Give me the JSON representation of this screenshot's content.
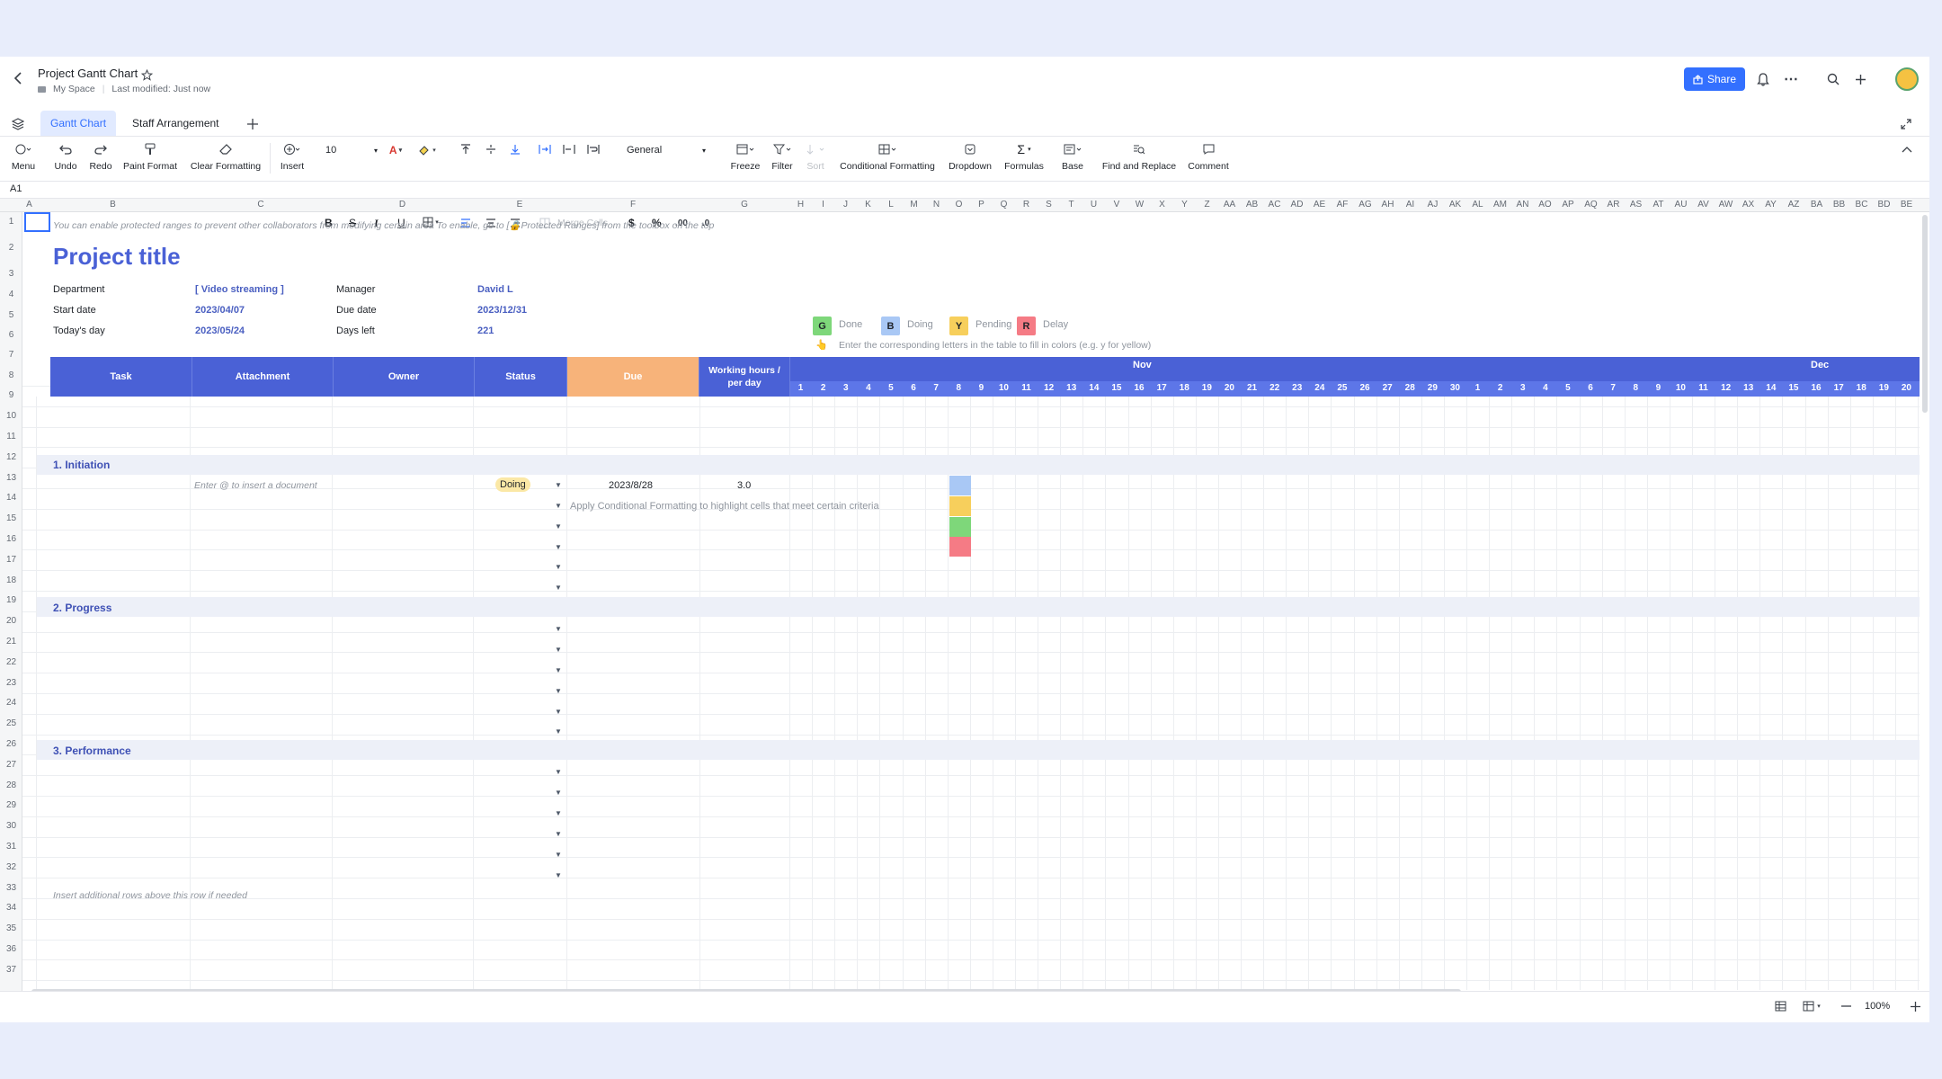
{
  "app": {
    "title": "Project Gantt Chart",
    "location": "My Space",
    "last_modified": "Last modified: Just now",
    "share_label": "Share"
  },
  "tabs": [
    {
      "label": "Gantt Chart",
      "active": true
    },
    {
      "label": "Staff Arrangement",
      "active": false
    }
  ],
  "toolbar": {
    "menu": "Menu",
    "undo": "Undo",
    "redo": "Redo",
    "paint_format": "Paint Format",
    "clear_formatting": "Clear Formatting",
    "insert": "Insert",
    "font_size": "10",
    "number_format": "General",
    "merge_cells": "Merge Cells",
    "freeze": "Freeze",
    "filter": "Filter",
    "sort": "Sort",
    "conditional_formatting": "Conditional Formatting",
    "dropdown": "Dropdown",
    "formulas": "Formulas",
    "base": "Base",
    "find_replace": "Find and Replace",
    "comment": "Comment",
    "bold": "B",
    "strike": "S",
    "italic": "I",
    "underline": "U",
    "currency": "$",
    "percent": "%"
  },
  "formula_bar": {
    "cell_ref": "A1"
  },
  "columns": [
    "A",
    "B",
    "C",
    "D",
    "E",
    "F",
    "G",
    "H",
    "I",
    "J",
    "K",
    "L",
    "M",
    "N",
    "O",
    "P",
    "Q",
    "R",
    "S",
    "T",
    "U",
    "V",
    "W",
    "X",
    "Y",
    "Z",
    "AA",
    "AB",
    "AC",
    "AD",
    "AE",
    "AF",
    "AG",
    "AH",
    "AI",
    "AJ",
    "AK",
    "AL",
    "AM",
    "AN",
    "AO",
    "AP",
    "AQ",
    "AR",
    "AS",
    "AT",
    "AU",
    "AV",
    "AW",
    "AX",
    "AY",
    "AZ",
    "BA",
    "BB",
    "BC",
    "BD",
    "BE"
  ],
  "rows": [
    "1",
    "2",
    "3",
    "4",
    "5",
    "6",
    "7",
    "8",
    "9",
    "10",
    "11",
    "12",
    "13",
    "14",
    "15",
    "16",
    "17",
    "18",
    "19",
    "20",
    "21",
    "22",
    "23",
    "24",
    "25",
    "26",
    "27",
    "28",
    "29",
    "30",
    "31",
    "32",
    "33",
    "34",
    "35",
    "36",
    "37"
  ],
  "sheet": {
    "note": "You can enable protected ranges to prevent other collaborators from modifying certain area To enable, go to [🔒Protected Ranges] from the toolbox on the top",
    "project_title": "Project title",
    "department_label": "Department",
    "department": "[ Video streaming ]",
    "manager_label": "Manager",
    "manager": "David L",
    "start_label": "Start date",
    "start": "2023/04/07",
    "due_label": "Due date",
    "due": "2023/12/31",
    "today_label": "Today's day",
    "today": "2023/05/24",
    "days_left_label": "Days left",
    "days_left": "221",
    "legend": [
      {
        "key": "G",
        "label": "Done",
        "color": "#7ed77a"
      },
      {
        "key": "B",
        "label": "Doing",
        "color": "#a9c8f5"
      },
      {
        "key": "Y",
        "label": "Pending",
        "color": "#f7cf5c"
      },
      {
        "key": "R",
        "label": "Delay",
        "color": "#f57b85"
      }
    ],
    "legend_hint": "Enter the corresponding letters in the table to fill in colors (e.g. y for yellow)",
    "headers": {
      "task": "Task",
      "attachment": "Attachment",
      "owner": "Owner",
      "status": "Status",
      "due": "Due",
      "working_hours": "Working hours / per day"
    },
    "months": [
      "Nov",
      "Dec"
    ],
    "days": [
      "1",
      "2",
      "3",
      "4",
      "5",
      "6",
      "7",
      "8",
      "9",
      "10",
      "11",
      "12",
      "13",
      "14",
      "15",
      "16",
      "17",
      "18",
      "19",
      "20",
      "21",
      "22",
      "23",
      "24",
      "25",
      "26",
      "27",
      "28",
      "29",
      "30",
      "1",
      "2",
      "3",
      "4",
      "5",
      "6",
      "7",
      "8",
      "9",
      "10",
      "11",
      "12",
      "13",
      "14",
      "15",
      "16",
      "17",
      "18",
      "19",
      "20"
    ],
    "sections": [
      "1. Initiation",
      "2. Progress",
      "3. Performance"
    ],
    "row10": {
      "attachment_hint": "Enter @ to insert a document",
      "status": "Doing",
      "due": "2023/8/28",
      "hours": "3.0"
    },
    "cf_hint": "Apply Conditional Formatting to highlight cells that meet certain criteria",
    "insert_hint": "Insert additional rows above this row if needed",
    "swatch_colors": [
      "#a9c8f5",
      "#f7cf5c",
      "#7ed77a",
      "#f57b85"
    ],
    "header_blue": "#4a61d6",
    "header_orange": "#f7b37a"
  },
  "status_bar": {
    "zoom": "100%"
  }
}
